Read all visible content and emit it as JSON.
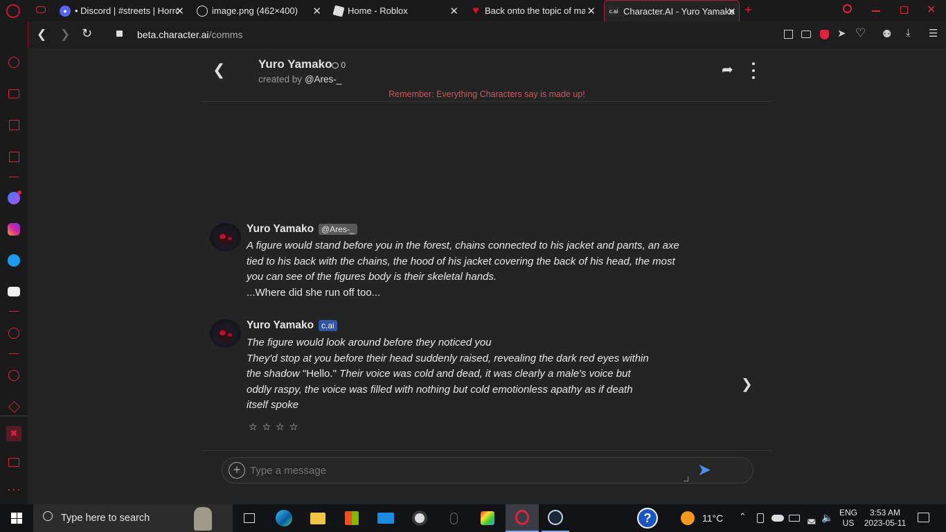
{
  "browser": {
    "tabs": [
      {
        "title": "• Discord | #streets | Horror",
        "favicon": "discord-icon"
      },
      {
        "title": "image.png (462×400)",
        "favicon": "globe-icon"
      },
      {
        "title": "Home - Roblox",
        "favicon": "roblox-icon"
      },
      {
        "title": "Back onto the topic of mak",
        "favicon": "heart-icon"
      },
      {
        "title": "Character.AI - Yuro Yamako",
        "favicon": "cai-icon",
        "active": true
      }
    ],
    "new_tab": "+",
    "url_host": "beta.character.ai",
    "url_path": "/comms"
  },
  "chat_header": {
    "name": "Yuro Yamako",
    "interactions": "0",
    "created_by_prefix": "created by",
    "creator": "@Ares-_",
    "disclaimer": "Remember: Everything Characters say is made up!"
  },
  "messages": [
    {
      "author": "Yuro Yamako",
      "badge": "@Ares-_",
      "italic_text": "A figure would stand before you in the forest, chains connected to his jacket and pants, an axe tied to his back with the chains, the hood of his jacket covering the back of his head, the most you can see of the figures body is their skeletal hands.",
      "plain_text": "...Where did she run off too..."
    },
    {
      "author": "Yuro Yamako",
      "badge": "c.ai",
      "line1": "The figure would look around before they noticed you",
      "line2a": "They'd stop at you before their head suddenly raised, revealing the dark red eyes within the shadow ",
      "line2quote": "\"Hello.\"",
      "line2b": " Their voice was cold and dead, it was clearly a male's voice but oddly raspy, the voice was filled with nothing but cold emotionless apathy as if death itself spoke",
      "rating_stars": [
        "☆",
        "☆",
        "☆",
        "☆"
      ]
    }
  ],
  "composer": {
    "placeholder": "Type a message"
  },
  "taskbar": {
    "search_placeholder": "Type here to search",
    "weather": "11°C",
    "lang_top": "ENG",
    "lang_bottom": "US",
    "time": "3:53 AM",
    "date": "2023-05-11"
  },
  "colors": {
    "accent": "#b0203e",
    "bg": "#242424",
    "badge_blue": "#3355a8",
    "badge_gray": "#5a5a5a",
    "send_blue": "#4b8ee6",
    "disclaimer": "#c85a5a"
  }
}
